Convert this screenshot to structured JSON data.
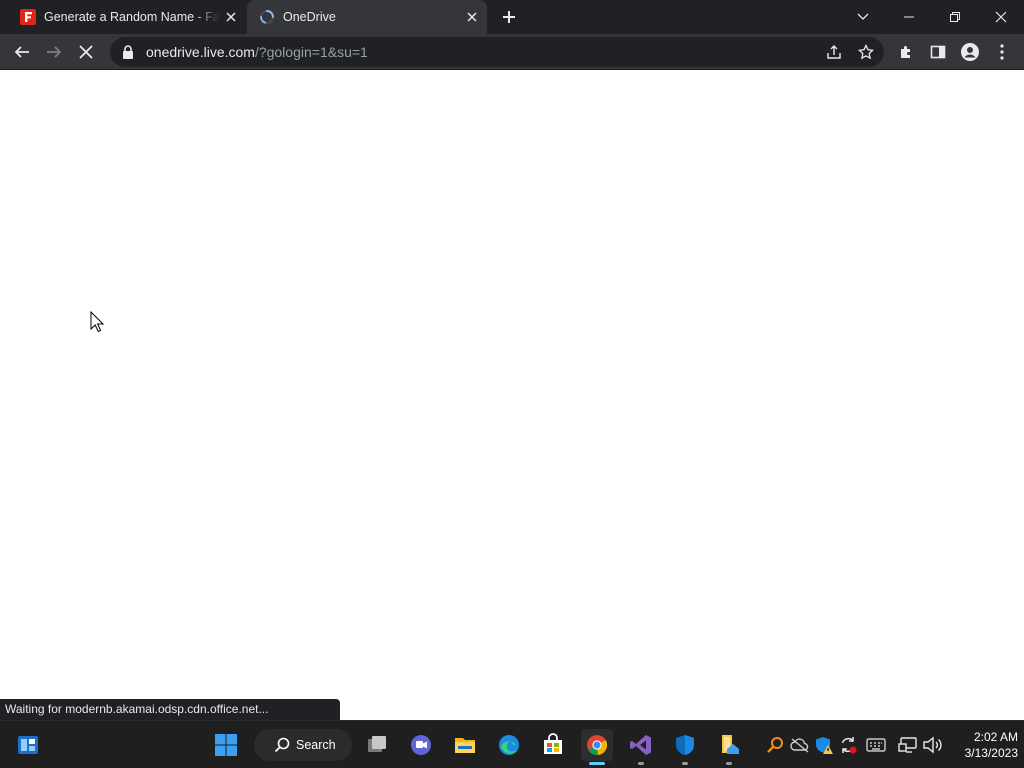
{
  "browser": {
    "tabs": [
      {
        "title": "Generate a Random Name - Fake Name Generator",
        "favicon": "fakenamegenerator-favicon",
        "active": false
      },
      {
        "title": "OneDrive",
        "favicon": "loading-spinner-icon",
        "active": true
      }
    ],
    "address": {
      "host": "onedrive.live.com",
      "path": "/?gologin=1&su=1"
    },
    "status_text": "Waiting for modernb.akamai.odsp.cdn.office.net..."
  },
  "taskbar": {
    "search_label": "Search",
    "clock": {
      "time": "2:02 AM",
      "date": "3/13/2023"
    },
    "apps": [
      "widgets-icon",
      "start-icon",
      "search-icon",
      "task-view-icon",
      "teams-chat-icon",
      "file-explorer-icon",
      "edge-icon",
      "microsoft-store-icon",
      "chrome-icon",
      "visual-studio-icon",
      "windows-security-icon",
      "file-explorer-pinned-icon"
    ],
    "tray": [
      "search-magnifier-tray-icon",
      "onedrive-offline-icon",
      "security-warning-icon",
      "sync-icon",
      "keyboard-icon",
      "network-icon",
      "volume-icon"
    ]
  },
  "colors": {
    "chrome_dark": "#202124",
    "toolbar": "#35363a",
    "taskbar": "#1f1f1f",
    "accent": "#60cdff",
    "page_bg": "#ffffff"
  }
}
